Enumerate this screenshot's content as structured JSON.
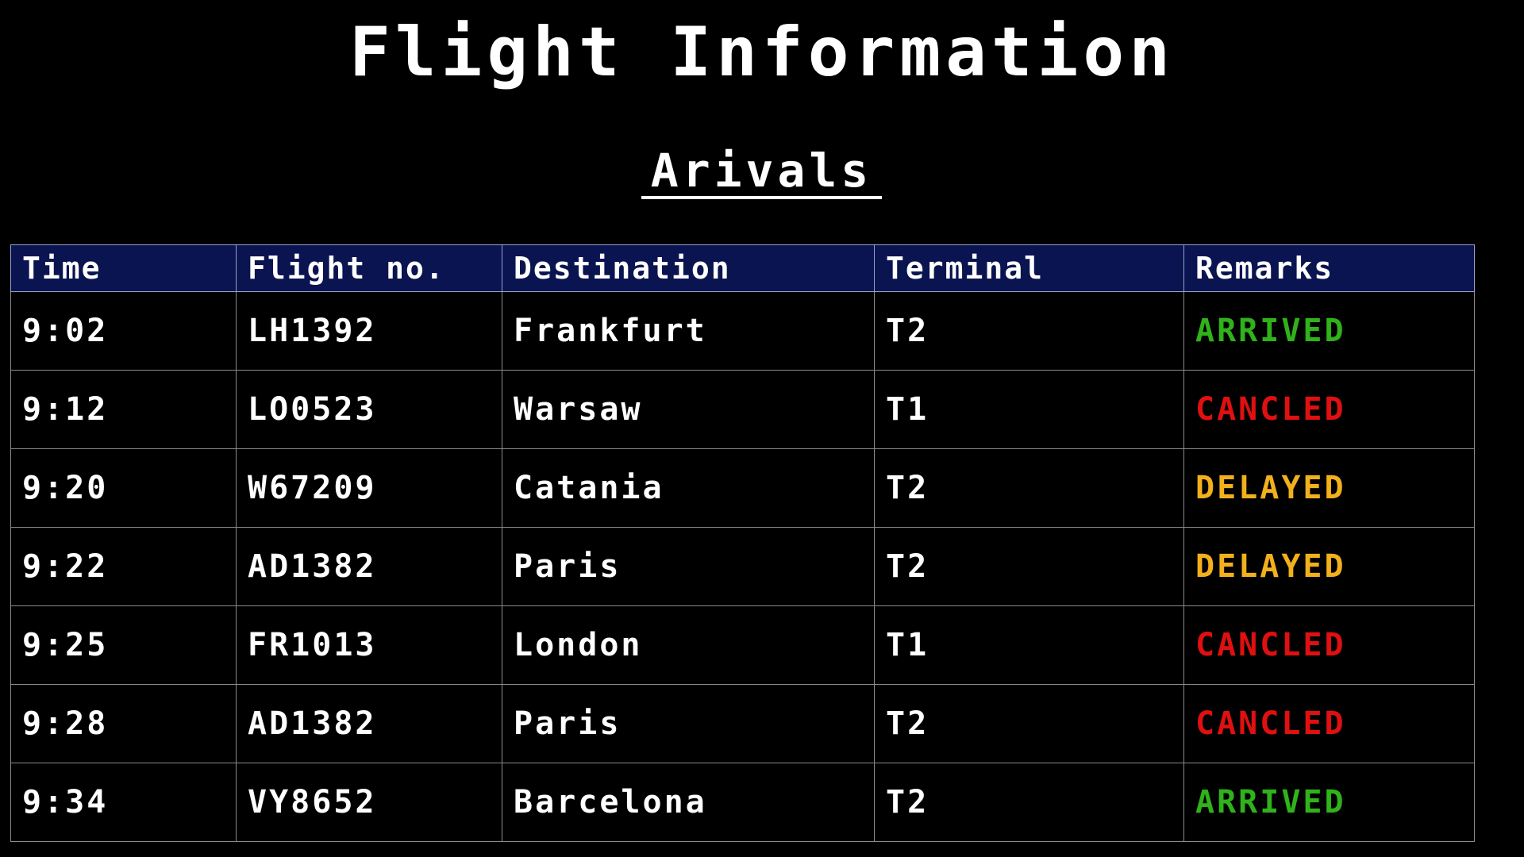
{
  "board": {
    "title": "Flight Information",
    "section": "Arivals",
    "columns": [
      "Time",
      "Flight no.",
      "Destination",
      "Terminal",
      "Remarks"
    ],
    "rows": [
      {
        "time": "9:02",
        "flight": "LH1392",
        "destination": "Frankfurt",
        "terminal": "T2",
        "remarks": "ARRIVED"
      },
      {
        "time": "9:12",
        "flight": "LO0523",
        "destination": "Warsaw",
        "terminal": "T1",
        "remarks": "CANCLED"
      },
      {
        "time": "9:20",
        "flight": "W67209",
        "destination": "Catania",
        "terminal": "T2",
        "remarks": "DELAYED"
      },
      {
        "time": "9:22",
        "flight": "AD1382",
        "destination": "Paris",
        "terminal": "T2",
        "remarks": "DELAYED"
      },
      {
        "time": "9:25",
        "flight": "FR1013",
        "destination": "London",
        "terminal": "T1",
        "remarks": "CANCLED"
      },
      {
        "time": "9:28",
        "flight": "AD1382",
        "destination": "Paris",
        "terminal": "T2",
        "remarks": "CANCLED"
      },
      {
        "time": "9:34",
        "flight": "VY8652",
        "destination": "Barcelona",
        "terminal": "T2",
        "remarks": "ARRIVED"
      }
    ]
  },
  "colors": {
    "background": "#000000",
    "header_background": "#0a1450",
    "text": "#ffffff",
    "arrived": "#2fb21a",
    "cancled": "#e01010",
    "delayed": "#f2b01c"
  }
}
